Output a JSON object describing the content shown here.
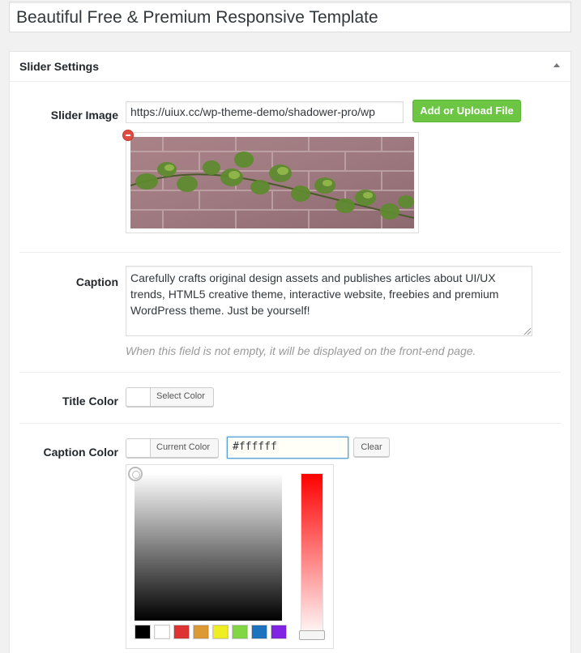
{
  "post_title": "Beautiful Free & Premium Responsive Template",
  "metabox": {
    "title": "Slider Settings"
  },
  "slider_image": {
    "label": "Slider Image",
    "url_value": "https://uiux.cc/wp-theme-demo/shadower-pro/wp",
    "upload_button": "Add or Upload File"
  },
  "caption": {
    "label": "Caption",
    "value": "Carefully crafts original design assets and publishes articles about UI/UX trends, HTML5 creative theme, interactive website, freebies and premium WordPress theme. Just be yourself!",
    "description": "When this field is not empty, it will be displayed on the front-end page."
  },
  "title_color": {
    "label": "Title Color",
    "button_text": "Select Color",
    "swatch_color": "#ffffff"
  },
  "caption_color": {
    "label": "Caption Color",
    "button_text": "Current Color",
    "hex_value": "#ffffff",
    "clear_button": "Clear",
    "swatch_color": "#ffffff"
  },
  "palette": [
    "#000000",
    "#ffffff",
    "#dd3333",
    "#dd9933",
    "#eeee22",
    "#81d742",
    "#1e73be",
    "#8224e3"
  ],
  "icons": {
    "toggle": "triangle-up-icon",
    "remove": "remove-icon"
  }
}
